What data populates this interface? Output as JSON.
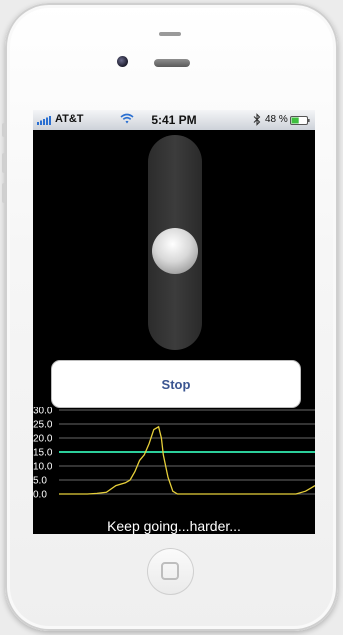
{
  "status_bar": {
    "carrier": "AT&T",
    "time": "5:41 PM",
    "battery_percent": "48 %",
    "battery_level": 0.48
  },
  "slider": {
    "level": 0.5
  },
  "stop_button": {
    "label": "Stop"
  },
  "feedback": {
    "text": "Keep going...harder..."
  },
  "colors": {
    "threshold_line": "#2ccf9b",
    "series_line": "#e6cf3a"
  },
  "chart_data": {
    "type": "line",
    "ylim": [
      0,
      30
    ],
    "y_ticks": [
      "30.0",
      "25.0",
      "20.0",
      "15.0",
      "10.0",
      "5.0",
      "0.0"
    ],
    "threshold": 15,
    "series": [
      {
        "x": [
          0,
          10,
          20,
          30,
          40,
          50,
          60,
          70,
          75,
          80,
          85,
          90,
          95,
          100,
          105,
          108,
          110,
          115,
          120,
          125,
          130,
          140,
          150,
          170,
          200,
          230,
          250,
          260,
          265,
          270
        ],
        "values": [
          0,
          0,
          0,
          0,
          0.2,
          0.6,
          3,
          4,
          5,
          8,
          12,
          14,
          18,
          23,
          24,
          20,
          14,
          6,
          1,
          0,
          0,
          0,
          0,
          0,
          0,
          0,
          0,
          1,
          2,
          3
        ]
      }
    ]
  }
}
